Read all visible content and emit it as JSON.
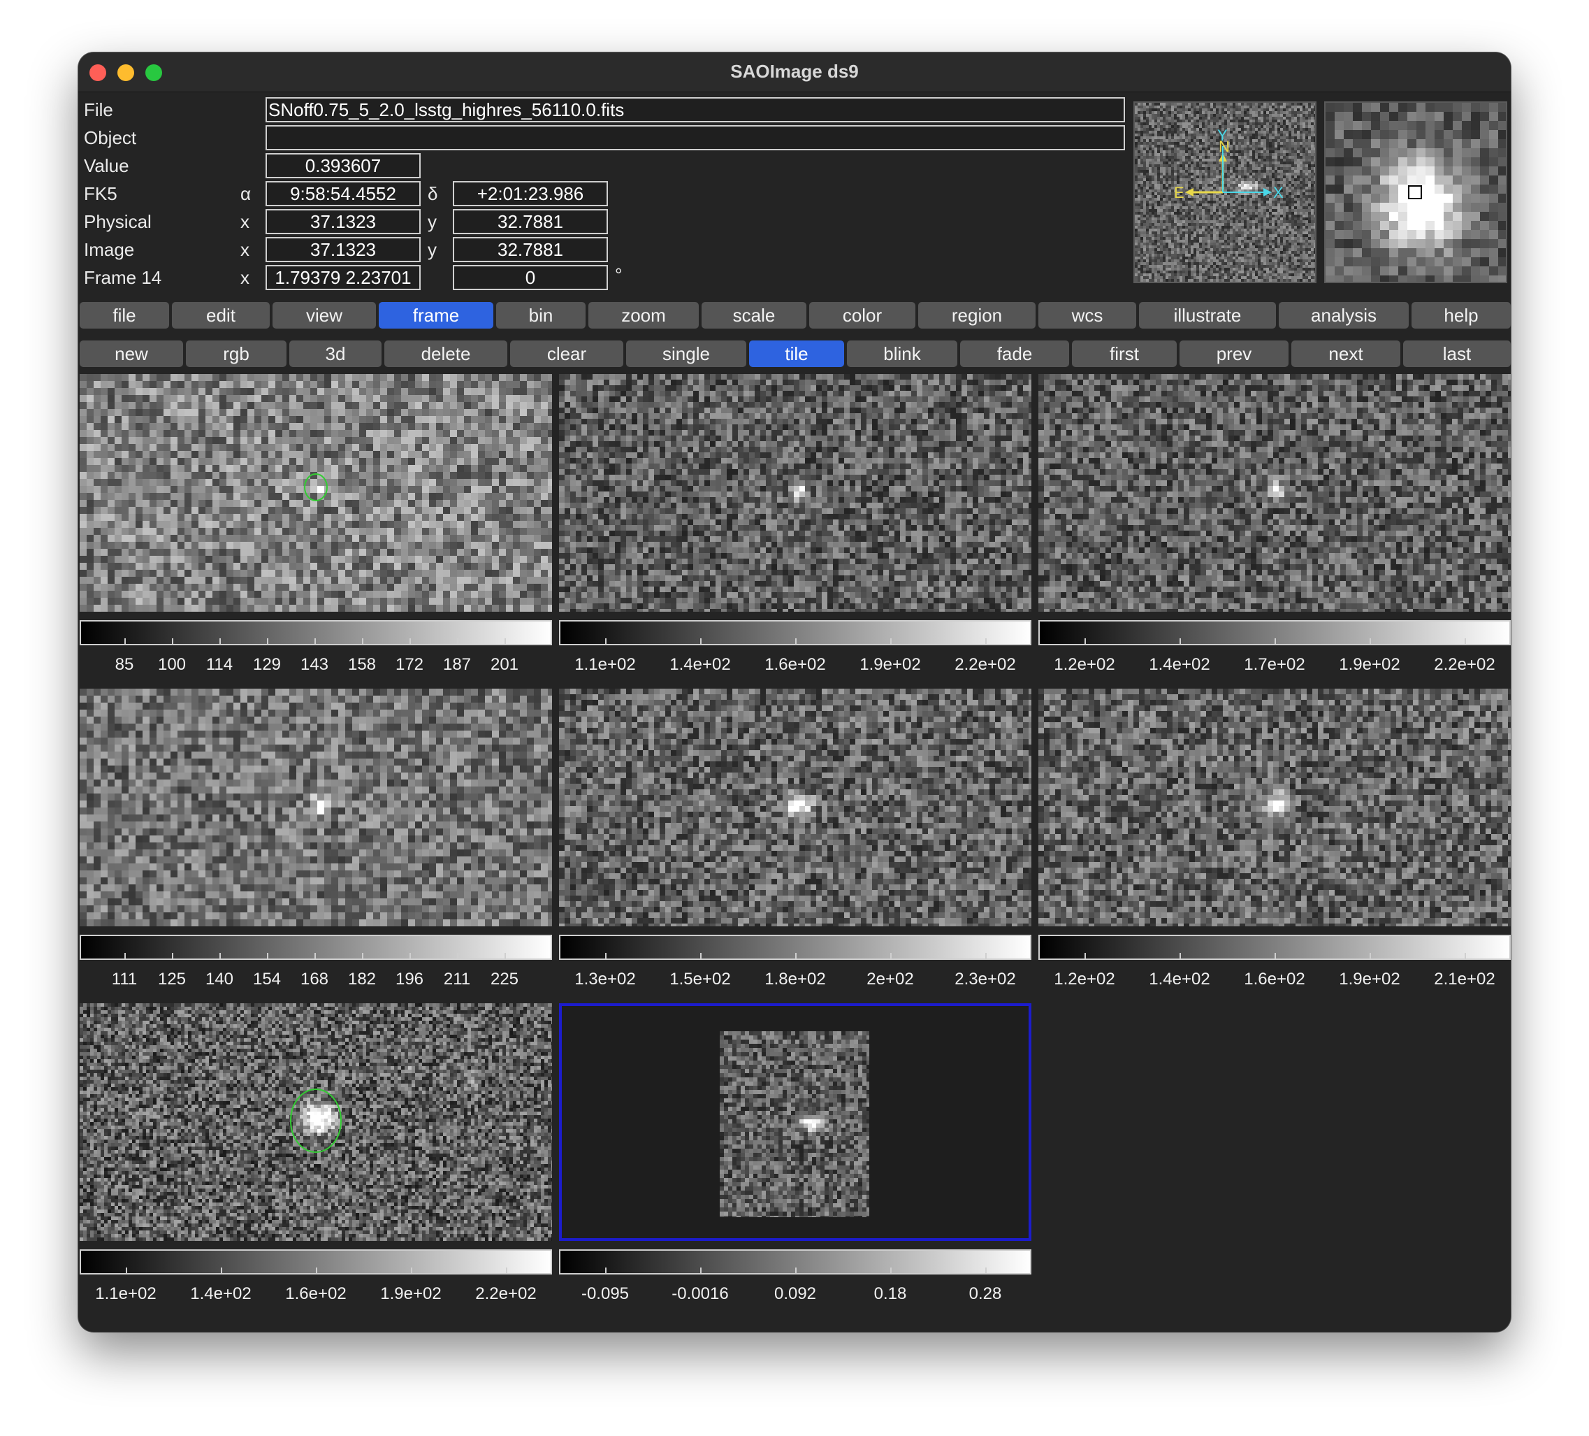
{
  "window": {
    "title": "SAOImage ds9"
  },
  "info": {
    "file_label": "File",
    "file_value": "SNoff0.75_5_2.0_lsstg_highres_56110.0.fits",
    "object_label": "Object",
    "object_value": "",
    "value_label": "Value",
    "value_value": "0.393607",
    "fk5_label": "FK5",
    "fk5_alpha_symbol": "α",
    "fk5_alpha": "9:58:54.4552",
    "fk5_delta_symbol": "δ",
    "fk5_delta": "+2:01:23.986",
    "physical_label": "Physical",
    "physical_x_symbol": "x",
    "physical_x": "37.1323",
    "physical_y_symbol": "y",
    "physical_y": "32.7881",
    "image_label": "Image",
    "image_x_symbol": "x",
    "image_x": "37.1323",
    "image_y_symbol": "y",
    "image_y": "32.7881",
    "frame_label": "Frame 14",
    "frame_x_symbol": "x",
    "frame_zoom": "1.79379 2.23701",
    "frame_angle": "0",
    "frame_degree_symbol": "°"
  },
  "panner": {
    "label_n": "N",
    "label_e": "E",
    "label_x": "X",
    "label_y": "Y"
  },
  "menu": [
    "file",
    "edit",
    "view",
    "frame",
    "bin",
    "zoom",
    "scale",
    "color",
    "region",
    "wcs",
    "illustrate",
    "analysis",
    "help"
  ],
  "menu_active": "frame",
  "buttons": [
    "new",
    "rgb",
    "3d",
    "delete",
    "clear",
    "single",
    "tile",
    "blink",
    "fade",
    "first",
    "prev",
    "next",
    "last"
  ],
  "buttons_active": "tile",
  "colorbars": [
    [
      "85",
      "100",
      "114",
      "129",
      "143",
      "158",
      "172",
      "187",
      "201"
    ],
    [
      "1.1e+02",
      "1.4e+02",
      "1.6e+02",
      "1.9e+02",
      "2.2e+02"
    ],
    [
      "1.2e+02",
      "1.4e+02",
      "1.7e+02",
      "1.9e+02",
      "2.2e+02"
    ],
    [
      "111",
      "125",
      "140",
      "154",
      "168",
      "182",
      "196",
      "211",
      "225"
    ],
    [
      "1.3e+02",
      "1.5e+02",
      "1.8e+02",
      "2e+02",
      "2.3e+02"
    ],
    [
      "1.2e+02",
      "1.4e+02",
      "1.6e+02",
      "1.9e+02",
      "2.1e+02"
    ],
    [
      "1.1e+02",
      "1.4e+02",
      "1.6e+02",
      "1.9e+02",
      "2.2e+02"
    ],
    [
      "-0.095",
      "-0.0016",
      "0.092",
      "0.18",
      "0.28"
    ]
  ],
  "colors": {
    "accent": "#2e63e0",
    "region": "#33cc33",
    "active_frame": "#1c1ccc",
    "panner_wcs": "#e8d84a",
    "panner_image": "#4ad8e8"
  }
}
